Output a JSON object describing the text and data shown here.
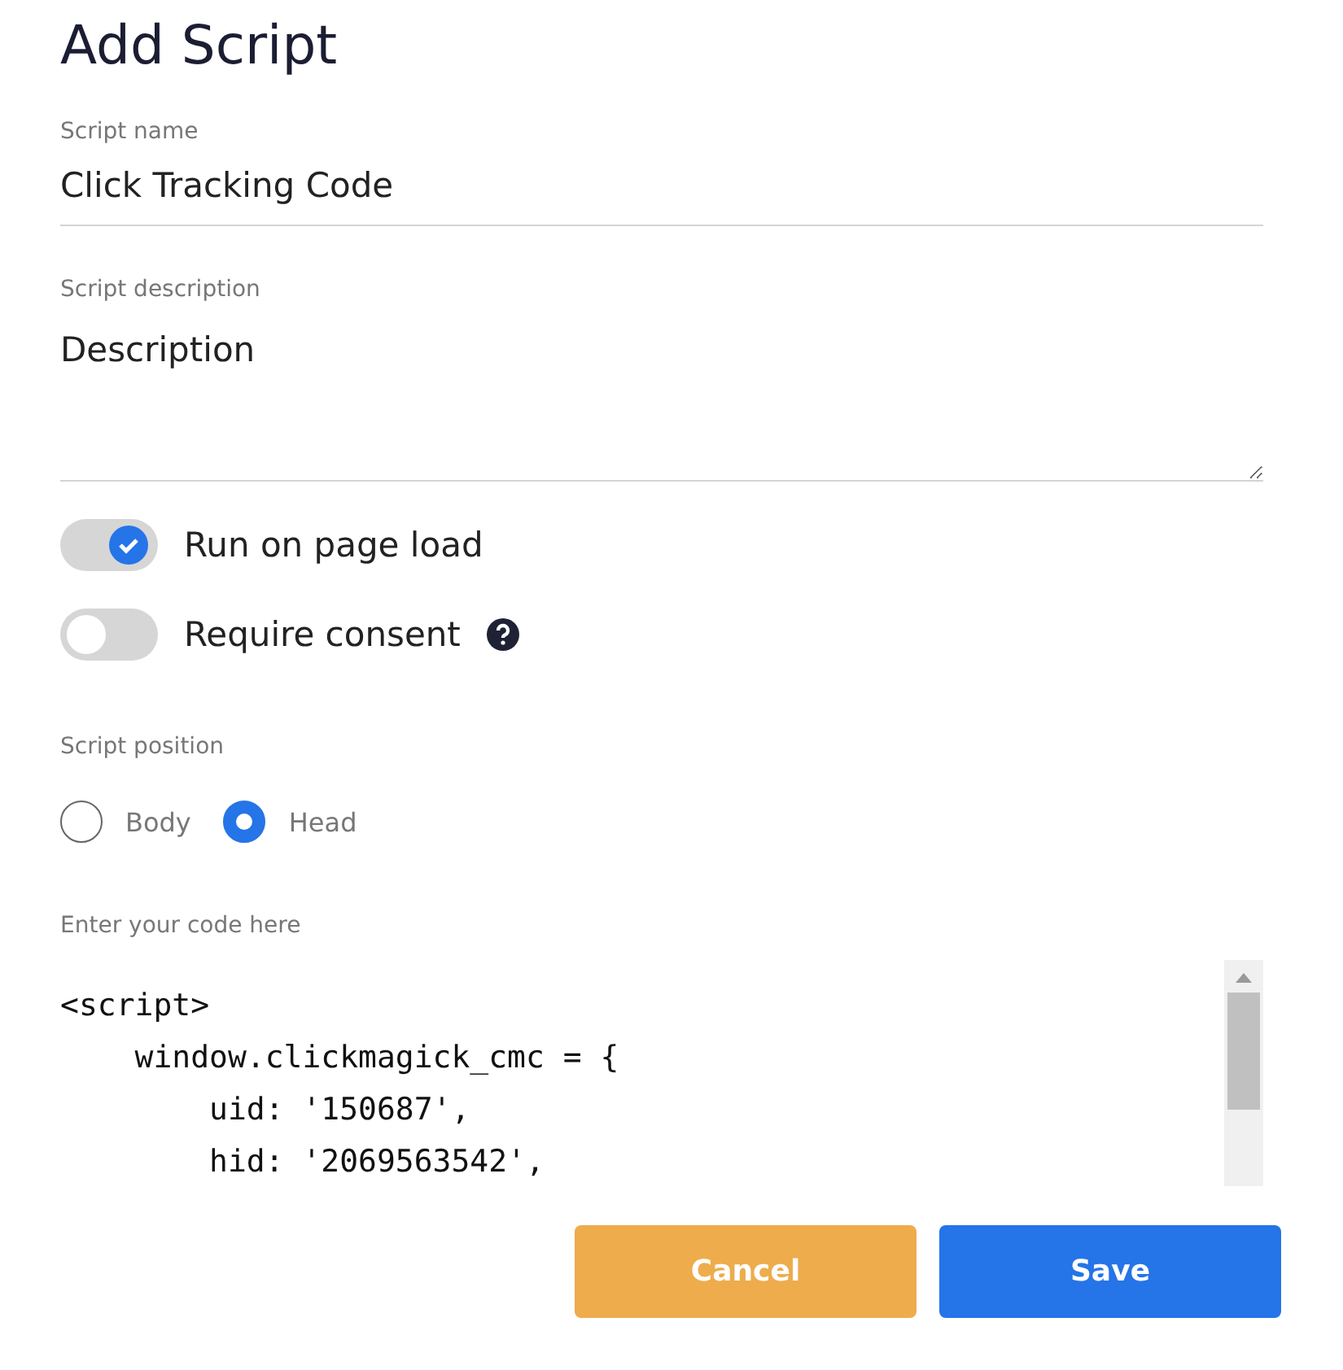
{
  "title": "Add Script",
  "name_field": {
    "label": "Script name",
    "value": "Click Tracking Code"
  },
  "description_field": {
    "label": "Script description",
    "placeholder": "Description"
  },
  "toggles": [
    {
      "label": "Run on page load",
      "on": true,
      "help": false
    },
    {
      "label": "Require consent",
      "on": false,
      "help": true
    }
  ],
  "position": {
    "label": "Script position",
    "options": [
      {
        "label": "Body",
        "selected": false
      },
      {
        "label": "Head",
        "selected": true
      }
    ]
  },
  "code": {
    "label": "Enter your code here",
    "lines": [
      "<script>",
      "    window.clickmagick_cmc = {",
      "        uid: '150687',",
      "        hid: '2069563542',"
    ]
  },
  "buttons": [
    {
      "label": "Cancel",
      "kind": "secondary"
    },
    {
      "label": "Save",
      "kind": "primary"
    }
  ]
}
